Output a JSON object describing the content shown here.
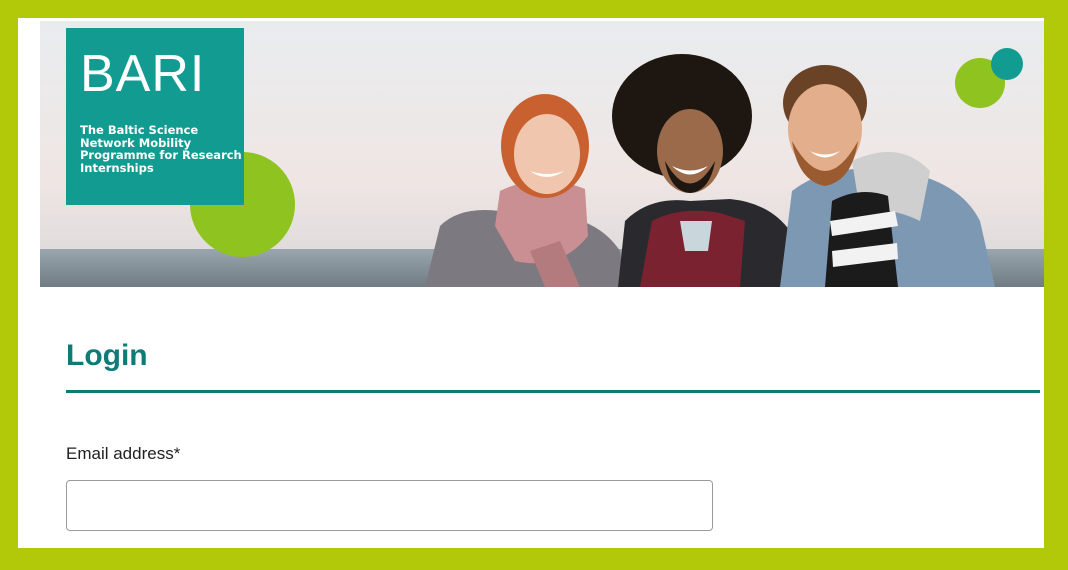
{
  "logo": {
    "title": "BARI",
    "tagline": "The Baltic Science Network Mobility Programme for Research Internships"
  },
  "colors": {
    "frame": "#b2c90a",
    "brand_teal": "#129c91",
    "heading_teal": "#0f7b77",
    "accent_green": "#8fc31f"
  },
  "icons": {
    "dots": "green-teal-dots-icon",
    "circle": "green-circle-decoration"
  },
  "login": {
    "title": "Login",
    "email_label": "Email address*",
    "email_value": "",
    "email_placeholder": ""
  }
}
